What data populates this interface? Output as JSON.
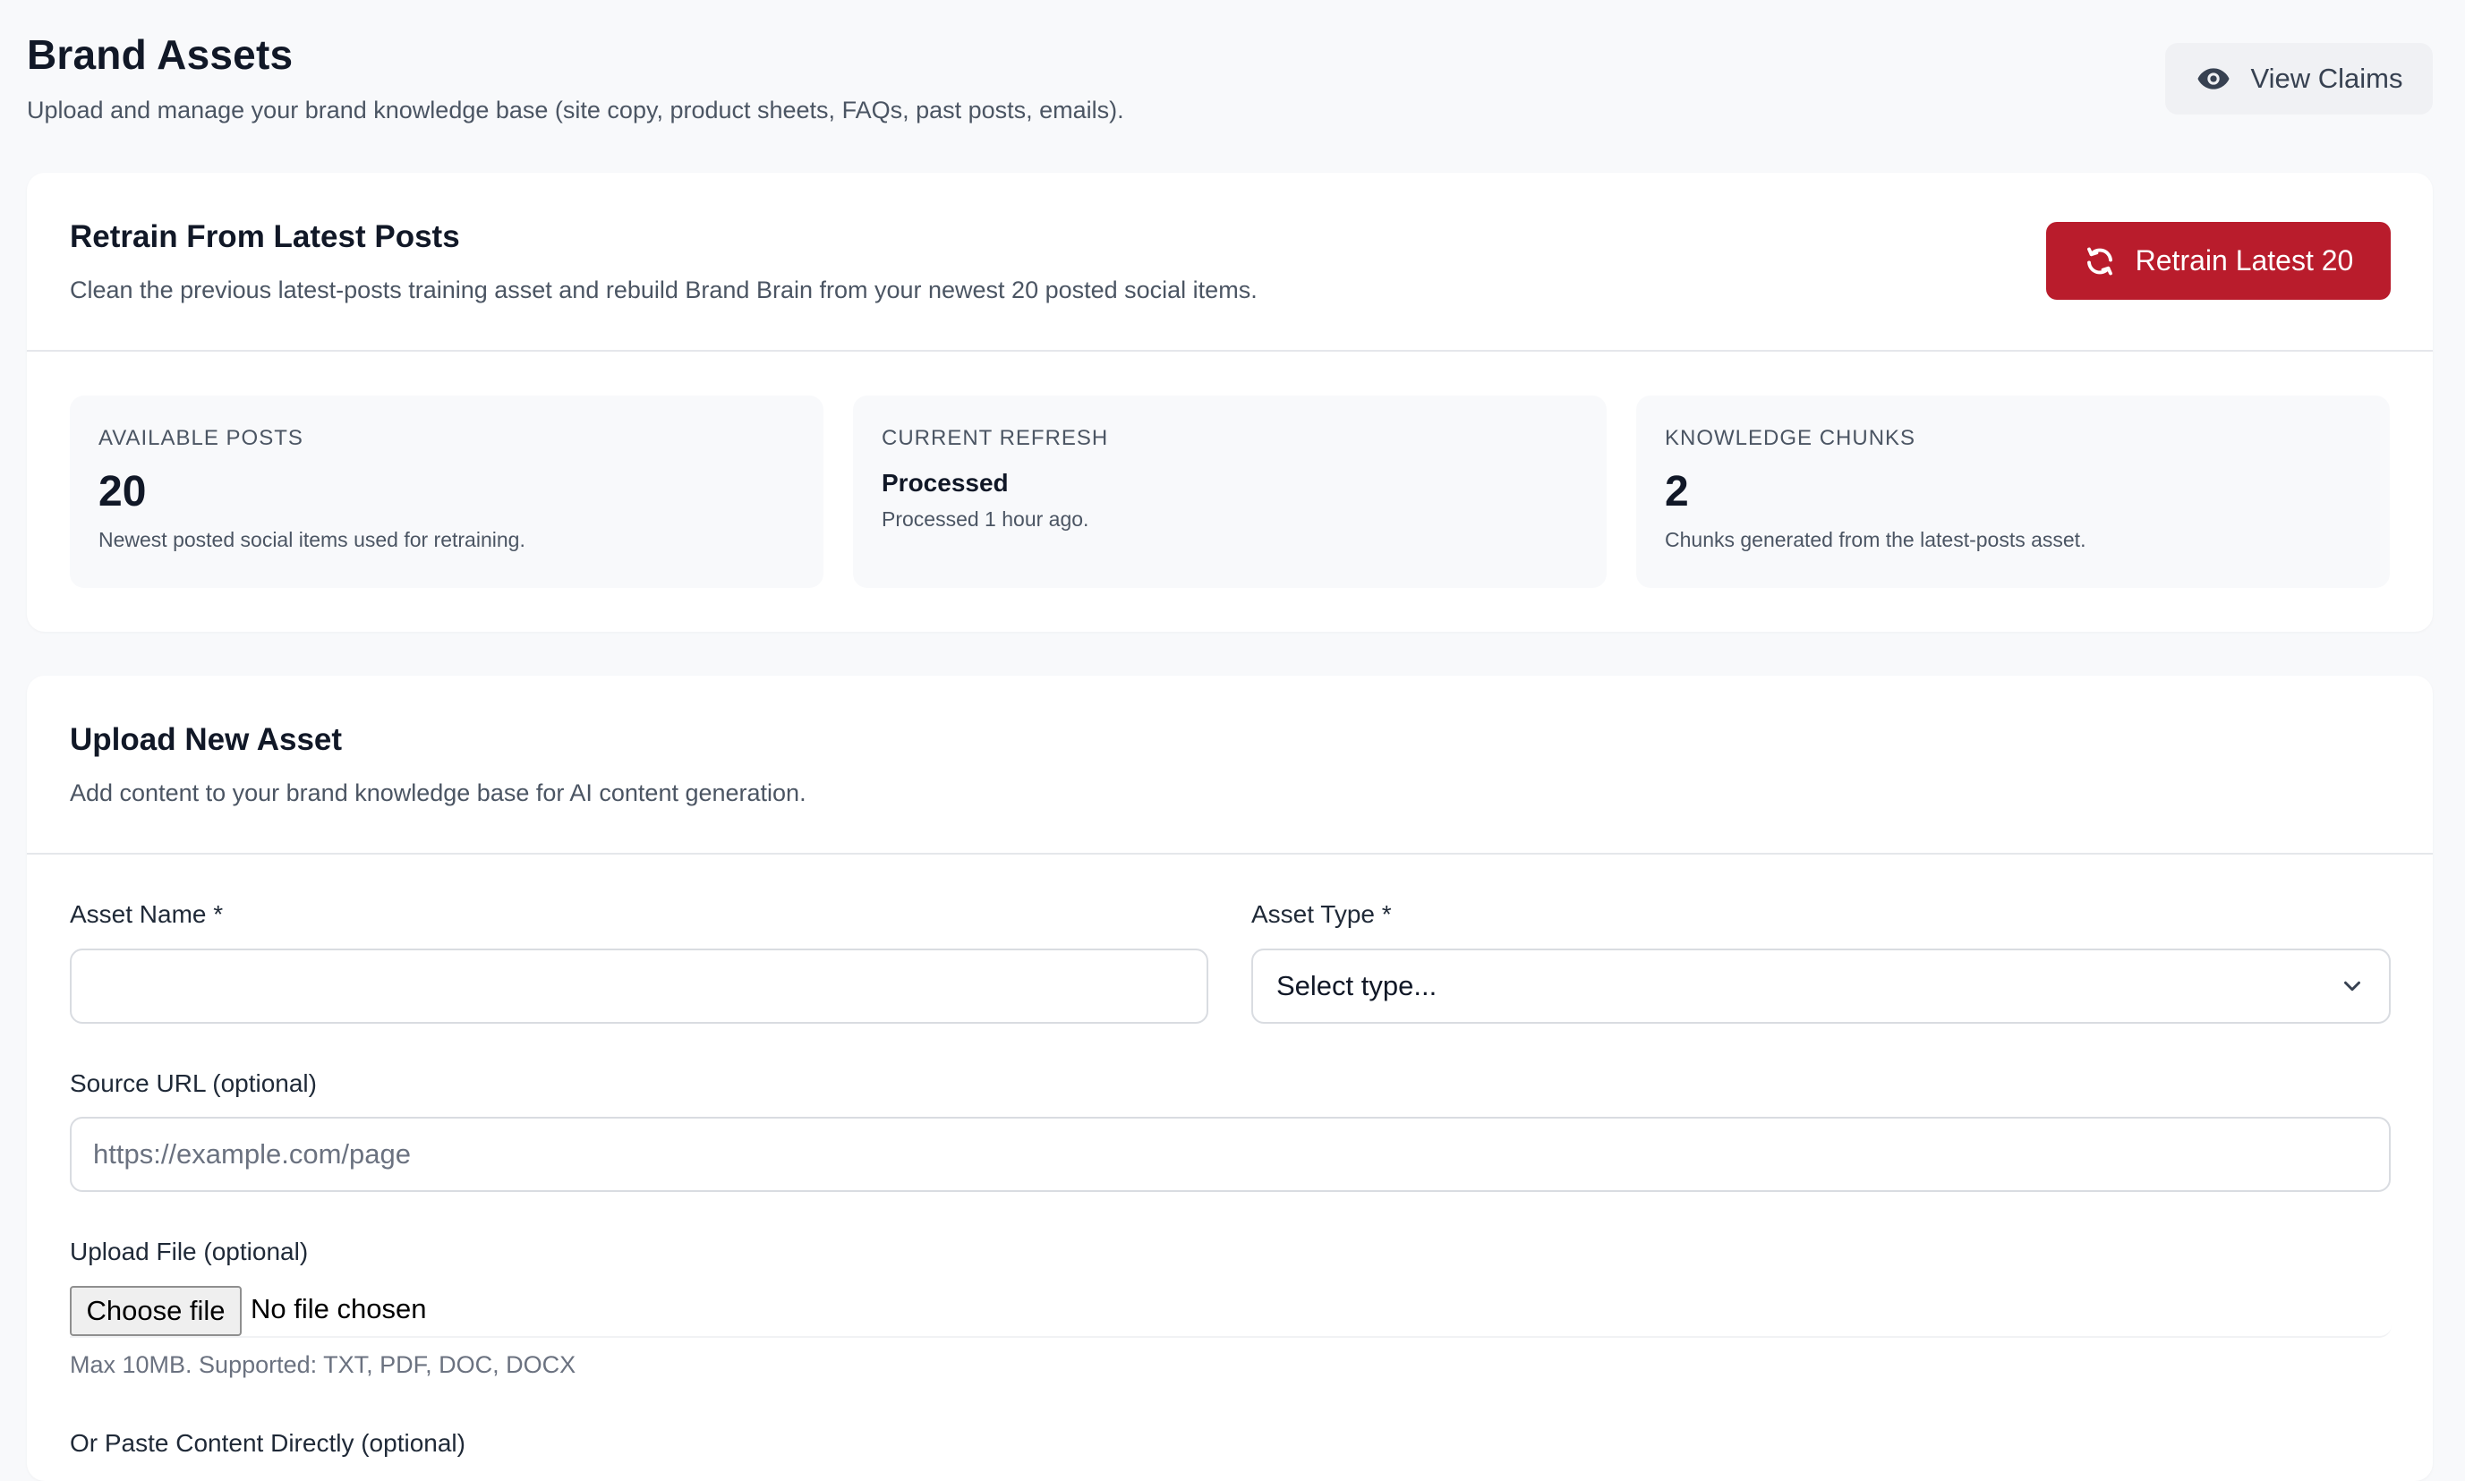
{
  "header": {
    "title": "Brand Assets",
    "subtitle": "Upload and manage your brand knowledge base (site copy, product sheets, FAQs, past posts, emails).",
    "view_claims_label": "View Claims",
    "view_claims_icon": "eye-icon"
  },
  "retrain": {
    "title": "Retrain From Latest Posts",
    "description": "Clean the previous latest-posts training asset and rebuild Brand Brain from your newest 20 posted social items.",
    "button_label": "Retrain Latest 20",
    "button_icon": "refresh-icon",
    "button_color": "#b91c2c",
    "stats": {
      "available": {
        "label": "AVAILABLE POSTS",
        "value": "20",
        "note": "Newest posted social items used for retraining."
      },
      "refresh": {
        "label": "CURRENT REFRESH",
        "status": "Processed",
        "note": "Processed 1 hour ago."
      },
      "chunks": {
        "label": "KNOWLEDGE CHUNKS",
        "value": "2",
        "note": "Chunks generated from the latest-posts asset."
      }
    }
  },
  "upload": {
    "title": "Upload New Asset",
    "description": "Add content to your brand knowledge base for AI content generation.",
    "asset_name": {
      "label": "Asset Name *",
      "value": "",
      "placeholder": ""
    },
    "asset_type": {
      "label": "Asset Type *",
      "selected": "Select type..."
    },
    "source_url": {
      "label": "Source URL (optional)",
      "value": "",
      "placeholder": "https://example.com/page"
    },
    "file": {
      "label": "Upload File (optional)",
      "button_label": "Choose file",
      "status": "No file chosen",
      "hint": "Max 10MB. Supported: TXT, PDF, DOC, DOCX"
    },
    "paste_label": "Or Paste Content Directly (optional)"
  }
}
